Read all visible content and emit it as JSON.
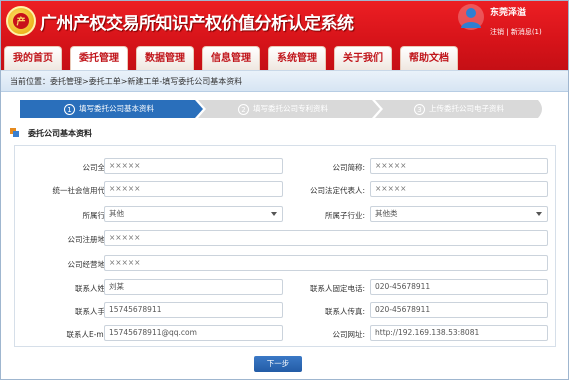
{
  "app": {
    "title": "广州产权交易所知识产权价值分析认定系统"
  },
  "user": {
    "name": "东莞泽溢",
    "logout": "注销",
    "messages": "新消息(1)",
    "sep": "|"
  },
  "nav": {
    "tabs": [
      "我的首页",
      "委托管理",
      "数据管理",
      "信息管理",
      "系统管理",
      "关于我们",
      "帮助文档"
    ],
    "active_index": 1
  },
  "breadcrumb": "当前位置：委托管理>委托工单>新建工单-填写委托公司基本资料",
  "steps": [
    {
      "num": "1",
      "label": "填写委托公司基本资料",
      "state": "active"
    },
    {
      "num": "2",
      "label": "填写委托公司专利资料",
      "state": "pending"
    },
    {
      "num": "3",
      "label": "上传委托公司电子资料",
      "state": "pending"
    }
  ],
  "section": {
    "title": "委托公司基本资料"
  },
  "form": {
    "company_name": {
      "label": "公司全称:",
      "value": "×××××"
    },
    "company_short": {
      "label": "公司简称:",
      "value": "×××××"
    },
    "credit_code": {
      "label": "统一社会信用代码:",
      "value": "×××××"
    },
    "legal_rep": {
      "label": "公司法定代表人:",
      "value": "×××××"
    },
    "industry": {
      "label": "所属行业:",
      "value": "其他"
    },
    "sub_industry": {
      "label": "所属子行业:",
      "value": "其他类"
    },
    "reg_address": {
      "label": "公司注册地址:",
      "value": "×××××"
    },
    "biz_address": {
      "label": "公司经营地址:",
      "value": "×××××"
    },
    "contact_name": {
      "label": "联系人姓名:",
      "value": "刘某"
    },
    "contact_tel": {
      "label": "联系人固定电话:",
      "value": "020-45678911"
    },
    "contact_mobile": {
      "label": "联系人手机:",
      "value": "15745678911"
    },
    "contact_fax": {
      "label": "联系人传真:",
      "value": "020-45678911"
    },
    "contact_email": {
      "label": "联系人E-mail:",
      "value": "15745678911@qq.com"
    },
    "website": {
      "label": "公司网址:",
      "value": "http://192.169.138.53:8081"
    }
  },
  "buttons": {
    "next": "下一步"
  },
  "colors": {
    "header_red": "#d61319",
    "nav_text": "#c0141a",
    "step_active": "#2a6fbb",
    "step_pending": "#d9d9d9",
    "button_blue": "#2d67b4"
  }
}
